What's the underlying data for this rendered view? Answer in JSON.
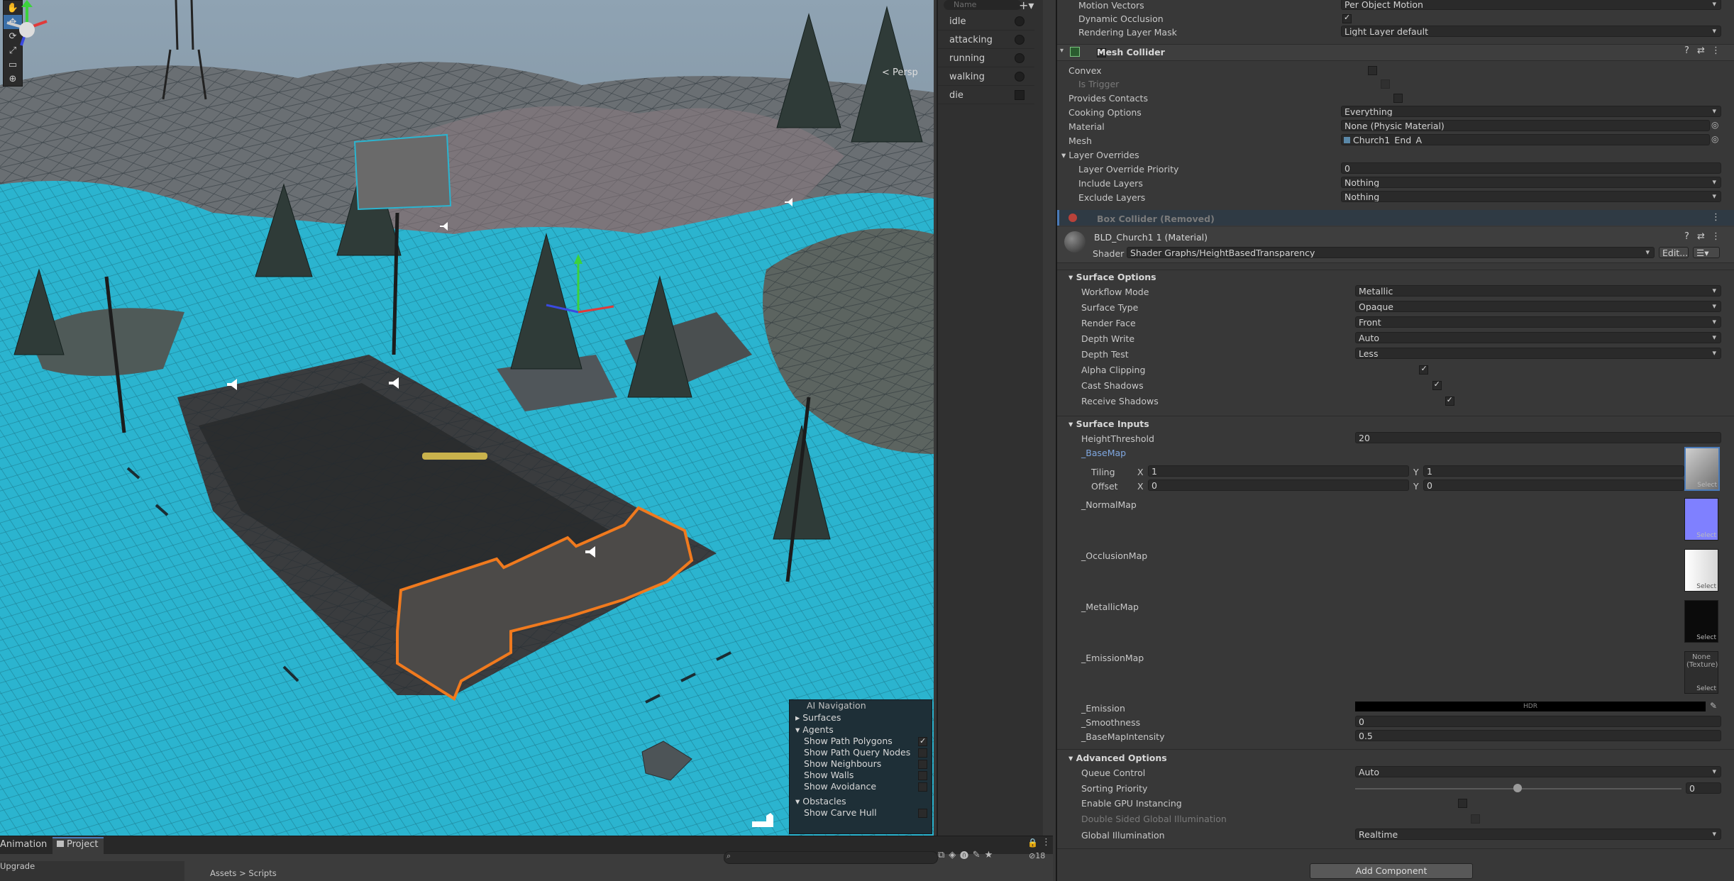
{
  "scene": {
    "tools": [
      "hand-tool",
      "move-tool",
      "rotate-tool",
      "scale-tool",
      "rect-tool",
      "transform-tool"
    ],
    "gizmo_label": "< Persp",
    "ai_navigation": {
      "title": "AI Navigation",
      "surfaces": "Surfaces",
      "agents": "Agents",
      "agent_options": [
        {
          "label": "Show Path Polygons",
          "checked": true
        },
        {
          "label": "Show Path Query Nodes",
          "checked": false
        },
        {
          "label": "Show Neighbours",
          "checked": false
        },
        {
          "label": "Show Walls",
          "checked": false
        },
        {
          "label": "Show Avoidance",
          "checked": false
        }
      ],
      "obstacles": "Obstacles",
      "obstacle_options": [
        {
          "label": "Show Carve Hull",
          "checked": false
        }
      ]
    }
  },
  "animator": {
    "search_placeholder": "Name",
    "params": [
      {
        "name": "idle",
        "kind": "bool-round"
      },
      {
        "name": "attacking",
        "kind": "bool-round"
      },
      {
        "name": "running",
        "kind": "bool-round"
      },
      {
        "name": "walking",
        "kind": "bool-round"
      },
      {
        "name": "die",
        "kind": "trigger"
      }
    ]
  },
  "inspector": {
    "top_rows": [
      {
        "label": "Motion Vectors",
        "value": "Per Object Motion",
        "type": "dropdown"
      },
      {
        "label": "Dynamic Occlusion",
        "value": "",
        "type": "checkbox",
        "checked": true
      },
      {
        "label": "Rendering Layer Mask",
        "value": "Light Layer default",
        "type": "dropdown"
      }
    ],
    "mesh_collider": {
      "title": "Mesh Collider",
      "rows": [
        {
          "label": "Convex",
          "type": "checkbox",
          "checked": false,
          "value": ""
        },
        {
          "label": "Is Trigger",
          "type": "checkbox",
          "checked": false,
          "disabled": true,
          "value": ""
        },
        {
          "label": "Provides Contacts",
          "type": "checkbox",
          "checked": false,
          "value": ""
        },
        {
          "label": "Cooking Options",
          "type": "dropdown",
          "value": "Everything"
        },
        {
          "label": "Material",
          "type": "object",
          "value": "None (Physic Material)"
        },
        {
          "label": "Mesh",
          "type": "object",
          "value": "Church1_End_A"
        }
      ],
      "layer_overrides": "Layer Overrides",
      "override_rows": [
        {
          "label": "Layer Override Priority",
          "type": "text",
          "value": "0"
        },
        {
          "label": "Include Layers",
          "type": "dropdown",
          "value": "Nothing"
        },
        {
          "label": "Exclude Layers",
          "type": "dropdown",
          "value": "Nothing"
        }
      ]
    },
    "box_collider": {
      "title": "Box Collider (Removed)"
    },
    "material": {
      "title": "BLD_Church1 1 (Material)",
      "shader_label": "Shader",
      "shader_value": "Shader Graphs/HeightBasedTransparency",
      "edit_label": "Edit..."
    },
    "surface_options": {
      "title": "Surface Options",
      "rows": [
        {
          "label": "Workflow Mode",
          "type": "dropdown",
          "value": "Metallic"
        },
        {
          "label": "Surface Type",
          "type": "dropdown",
          "value": "Opaque"
        },
        {
          "label": "Render Face",
          "type": "dropdown",
          "value": "Front"
        },
        {
          "label": "Depth Write",
          "type": "dropdown",
          "value": "Auto"
        },
        {
          "label": "Depth Test",
          "type": "dropdown",
          "value": "Less"
        },
        {
          "label": "Alpha Clipping",
          "type": "checkbox",
          "checked": true,
          "value": ""
        },
        {
          "label": "Cast Shadows",
          "type": "checkbox",
          "checked": true,
          "value": ""
        },
        {
          "label": "Receive Shadows",
          "type": "checkbox",
          "checked": true,
          "value": ""
        }
      ]
    },
    "surface_inputs": {
      "title": "Surface Inputs",
      "height_threshold_label": "HeightThreshold",
      "height_threshold_value": "20",
      "basemap": "_BaseMap",
      "tiling": "Tiling",
      "offset": "Offset",
      "x": "X",
      "y": "Y",
      "tiling_x": "1",
      "tiling_y": "1",
      "offset_x": "0",
      "offset_y": "0",
      "normalmap": "_NormalMap",
      "occlusionmap": "_OcclusionMap",
      "metallicmap": "_MetallicMap",
      "emissionmap": "_EmissionMap",
      "none_texture": "None (Texture)",
      "select": "Select",
      "emission": "_Emission",
      "hdr": "HDR",
      "smoothness_label": "_Smoothness",
      "smoothness_value": "0",
      "basemapintensity_label": "_BaseMapIntensity",
      "basemapintensity_value": "0.5"
    },
    "advanced_options": {
      "title": "Advanced Options",
      "queue_control_label": "Queue Control",
      "queue_control_value": "Auto",
      "sorting_priority_label": "Sorting Priority",
      "sorting_priority_value": "0",
      "gpu_instancing_label": "Enable GPU Instancing",
      "double_sided_label": "Double Sided Global Illumination",
      "global_illumination_label": "Global Illumination",
      "global_illumination_value": "Realtime"
    },
    "add_component": "Add Component"
  },
  "bottom": {
    "tabs": [
      "Animation",
      "Project"
    ],
    "breadcrumb": [
      "Assets",
      "Scripts"
    ],
    "left_item": "Upgrade",
    "hidden_count": "18"
  },
  "colors": {
    "navmesh": "#2bb4cf",
    "selection": "#f07a1e",
    "panel": "#383838",
    "accent": "#3a6fa8"
  }
}
